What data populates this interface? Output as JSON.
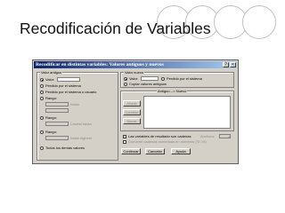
{
  "slide": {
    "title": "Recodificación de Variables"
  },
  "dialog": {
    "title": "Recodificar en distintas variables: Valores antiguos y nuevos",
    "close_glyph": "×",
    "help_glyph": "?",
    "old_value": {
      "group_label": "Valor antiguo",
      "value_label": "Valor:",
      "system_missing": "Perdido por el sistema",
      "system_or_user_missing": "Perdido por el sistema o usuario",
      "range_label": "Rango:",
      "through_label": "hasta",
      "range_lowest_label": "Rango:",
      "lowest_through_label": "Lowest hasta",
      "range_highest_label": "Rango:",
      "through_highest_label": "hasta highest",
      "all_other_values": "Todos los demás valores"
    },
    "new_value": {
      "group_label": "Valor nuevo",
      "value_label": "Valor:",
      "system_missing": "Perdido por el sistema",
      "copy_old_values": "Copiar valores antiguos"
    },
    "old_new_list": {
      "group_label": "Antiguo --> Nuevo",
      "add_button": "Añadir",
      "change_button": "Cambiar",
      "remove_button": "Borrar"
    },
    "string_output": {
      "label": "Las variables de resultado son cadenas",
      "width_label": "Anchura:",
      "width_value": "8"
    },
    "numeric_strings": {
      "label": "Convertir cadenas numéricas en números ('5'->5)"
    },
    "buttons": {
      "continue": "Continuar",
      "cancel": "Cancelar",
      "help": "Ayuda"
    }
  }
}
